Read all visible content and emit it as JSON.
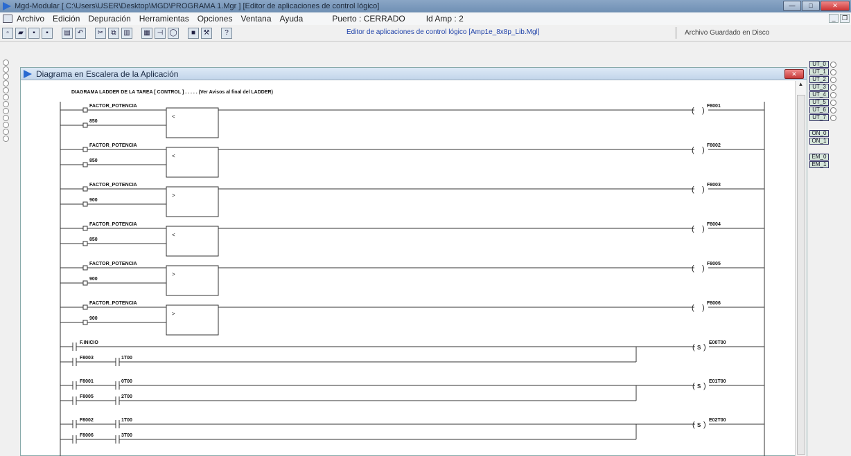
{
  "window": {
    "title": "Mgd-Modular   [ C:\\Users\\USER\\Desktop\\MGD\\PROGRAMA 1.Mgr ]   [Editor de aplicaciones de control lógico]"
  },
  "menu": {
    "items": [
      "Archivo",
      "Edición",
      "Depuración",
      "Herramientas",
      "Opciones",
      "Ventana",
      "Ayuda"
    ],
    "port_status": "Puerto :  CERRADO",
    "amp_id": "Id Amp :  2"
  },
  "toolbar": {
    "editor_label": "Editor de aplicaciones de control lógico   [Amp1e_8x8p_Lib.Mgl]",
    "save_status": "Archivo Guardado en Disco"
  },
  "ladder_window": {
    "title": "Diagrama en Escalera de la Aplicación",
    "header": "DIAGRAMA LADDER DE LA TAREA  [ CONTROL ] . . . . . (Ver Avisos al final del LADDER)",
    "compare_rungs": [
      {
        "input": "FACTOR_POTENCIA",
        "constant": "850",
        "operator": "<",
        "output": "F8001"
      },
      {
        "input": "FACTOR_POTENCIA",
        "constant": "850",
        "operator": "<",
        "output": "F8002"
      },
      {
        "input": "FACTOR_POTENCIA",
        "constant": "900",
        "operator": ">",
        "output": "F8003"
      },
      {
        "input": "FACTOR_POTENCIA",
        "constant": "850",
        "operator": "<",
        "output": "F8004"
      },
      {
        "input": "FACTOR_POTENCIA",
        "constant": "900",
        "operator": ">",
        "output": "F8005"
      },
      {
        "input": "FACTOR_POTENCIA",
        "constant": "900",
        "operator": ">",
        "output": "F8006"
      }
    ],
    "set_rungs": [
      {
        "contact": "F.INICIO",
        "coil_type": "S",
        "output": "E00T00",
        "branch": [
          "F8003",
          "1T00"
        ]
      },
      {
        "contact": "F8001",
        "contact2": "0T00",
        "coil_type": "S",
        "output": "E01T00",
        "branch": [
          "F8005",
          "2T00"
        ]
      },
      {
        "contact": "F8002",
        "contact2": "1T00",
        "coil_type": "S",
        "output": "E02T00",
        "branch": [
          "F8006",
          "3T00"
        ]
      }
    ]
  },
  "right_panel": {
    "outputs": [
      "UT_0",
      "UT_1",
      "UT_2",
      "UT_3",
      "UT_4",
      "UT_5",
      "UT_6",
      "UT_7"
    ],
    "on": [
      "ON_0",
      "ON_1"
    ],
    "em": [
      "EM_0",
      "EM_1"
    ]
  }
}
